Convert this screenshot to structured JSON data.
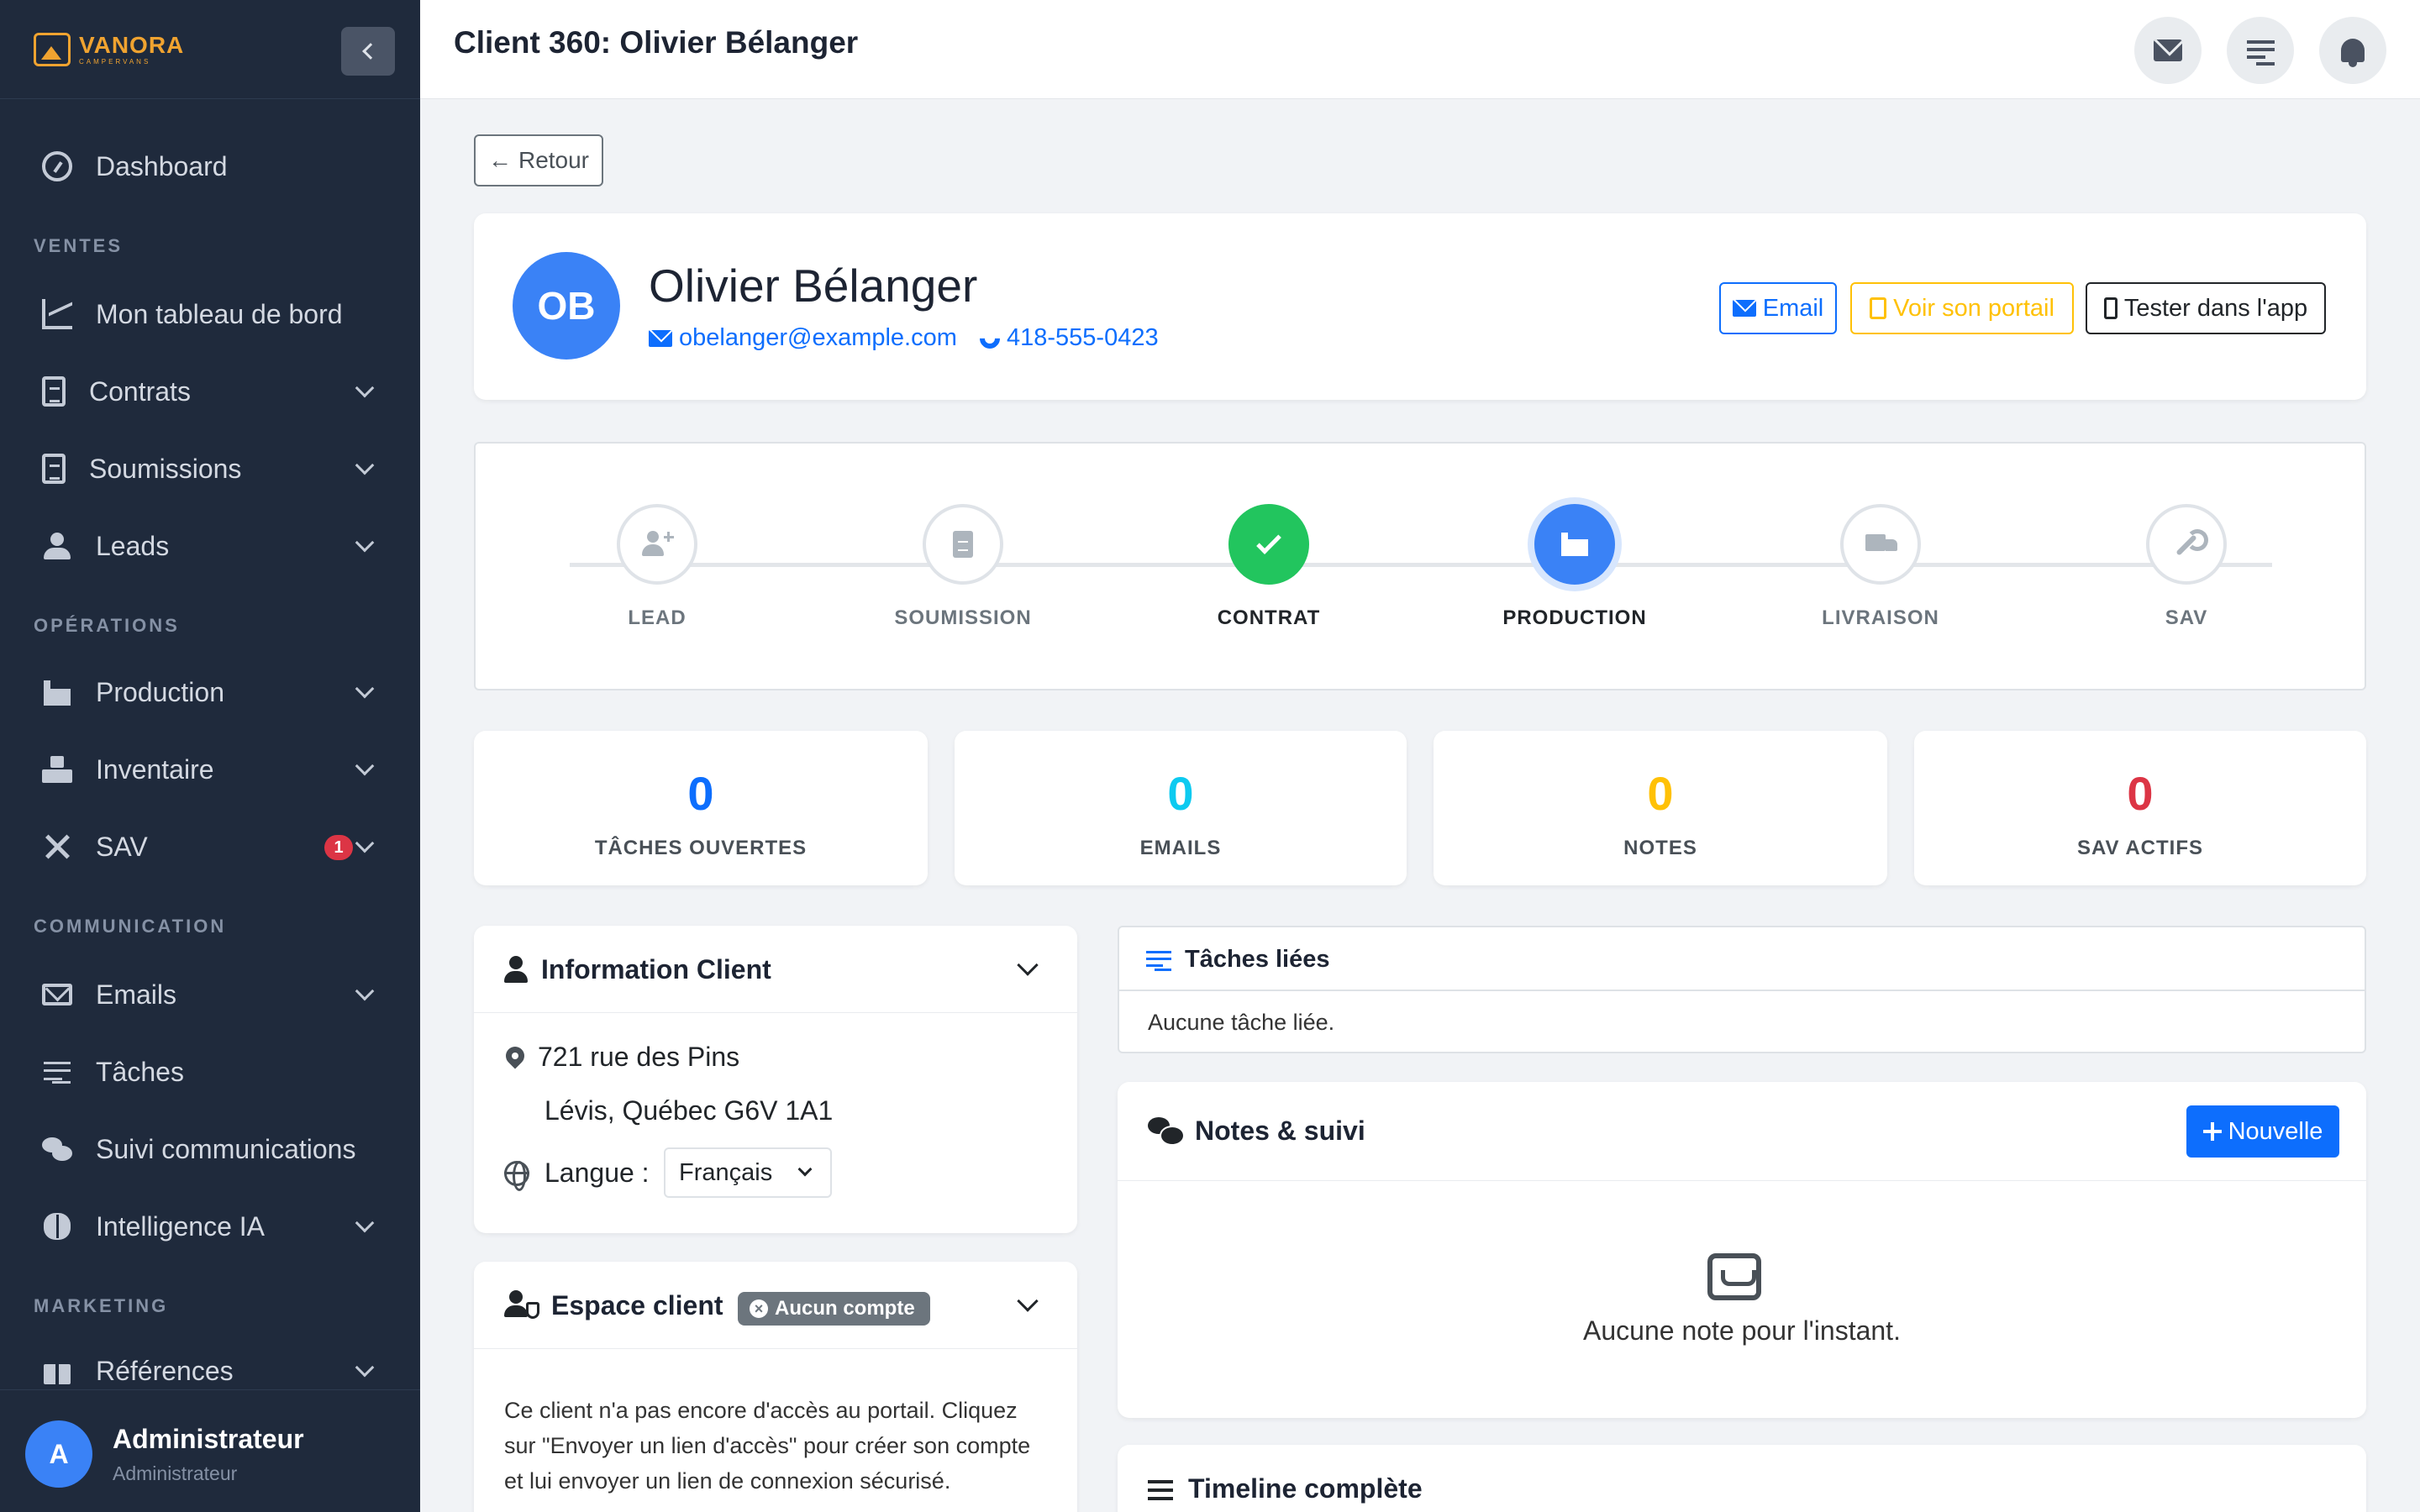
{
  "brand": {
    "name": "VANORA",
    "tagline": "CAMPERVANS"
  },
  "sidebar": {
    "sections": {
      "ventes": "VENTES",
      "operations": "OPÉRATIONS",
      "communication": "COMMUNICATION",
      "marketing": "MARKETING"
    },
    "items": {
      "dashboard": "Dashboard",
      "mon_tableau": "Mon tableau de bord",
      "contrats": "Contrats",
      "soumissions": "Soumissions",
      "leads": "Leads",
      "production": "Production",
      "inventaire": "Inventaire",
      "sav": "SAV",
      "emails": "Emails",
      "taches": "Tâches",
      "suivi": "Suivi communications",
      "intelligence": "Intelligence IA",
      "references": "Références"
    },
    "sav_badge": "1",
    "user": {
      "initial": "A",
      "name": "Administrateur",
      "role": "Administrateur"
    }
  },
  "header": {
    "title": "Client 360: Olivier Bélanger",
    "icons": [
      "envelope-icon",
      "tasks-icon",
      "bell-icon"
    ]
  },
  "back_label": "Retour",
  "client": {
    "initials": "OB",
    "name": "Olivier Bélanger",
    "email": "obelanger@example.com",
    "phone": "418-555-0423",
    "actions": {
      "email": "Email",
      "portal": "Voir son portail",
      "app": "Tester dans l'app"
    }
  },
  "pipeline": {
    "steps": [
      "LEAD",
      "SOUMISSION",
      "CONTRAT",
      "PRODUCTION",
      "LIVRAISON",
      "SAV"
    ],
    "completed": "CONTRAT",
    "current": "PRODUCTION"
  },
  "stats": [
    {
      "value": "0",
      "label": "TÂCHES OUVERTES",
      "color": "#0d6efd"
    },
    {
      "value": "0",
      "label": "EMAILS",
      "color": "#0dcaf0"
    },
    {
      "value": "0",
      "label": "NOTES",
      "color": "#ffc107"
    },
    {
      "value": "0",
      "label": "SAV ACTIFS",
      "color": "#dc3545"
    }
  ],
  "info_client": {
    "title": "Information Client",
    "address_line1": "721 rue des Pins",
    "address_line2": "Lévis, Québec G6V 1A1",
    "language_label": "Langue :",
    "language_value": "Français"
  },
  "espace_client": {
    "title": "Espace client",
    "badge": "Aucun compte",
    "text": "Ce client n'a pas encore d'accès au portail. Cliquez sur \"Envoyer un lien d'accès\" pour créer son compte et lui envoyer un lien de connexion sécurisé."
  },
  "taches_liees": {
    "title": "Tâches liées",
    "empty": "Aucune tâche liée."
  },
  "notes": {
    "title": "Notes & suivi",
    "new_label": "Nouvelle",
    "empty": "Aucune note pour l'instant."
  },
  "timeline": {
    "title": "Timeline complète"
  },
  "colors": {
    "sidebar": "#1f2a3c",
    "primary": "#0d6efd",
    "accent": "#f0a330",
    "success": "#22c55e",
    "warning": "#ffc107",
    "danger": "#dc3545"
  }
}
